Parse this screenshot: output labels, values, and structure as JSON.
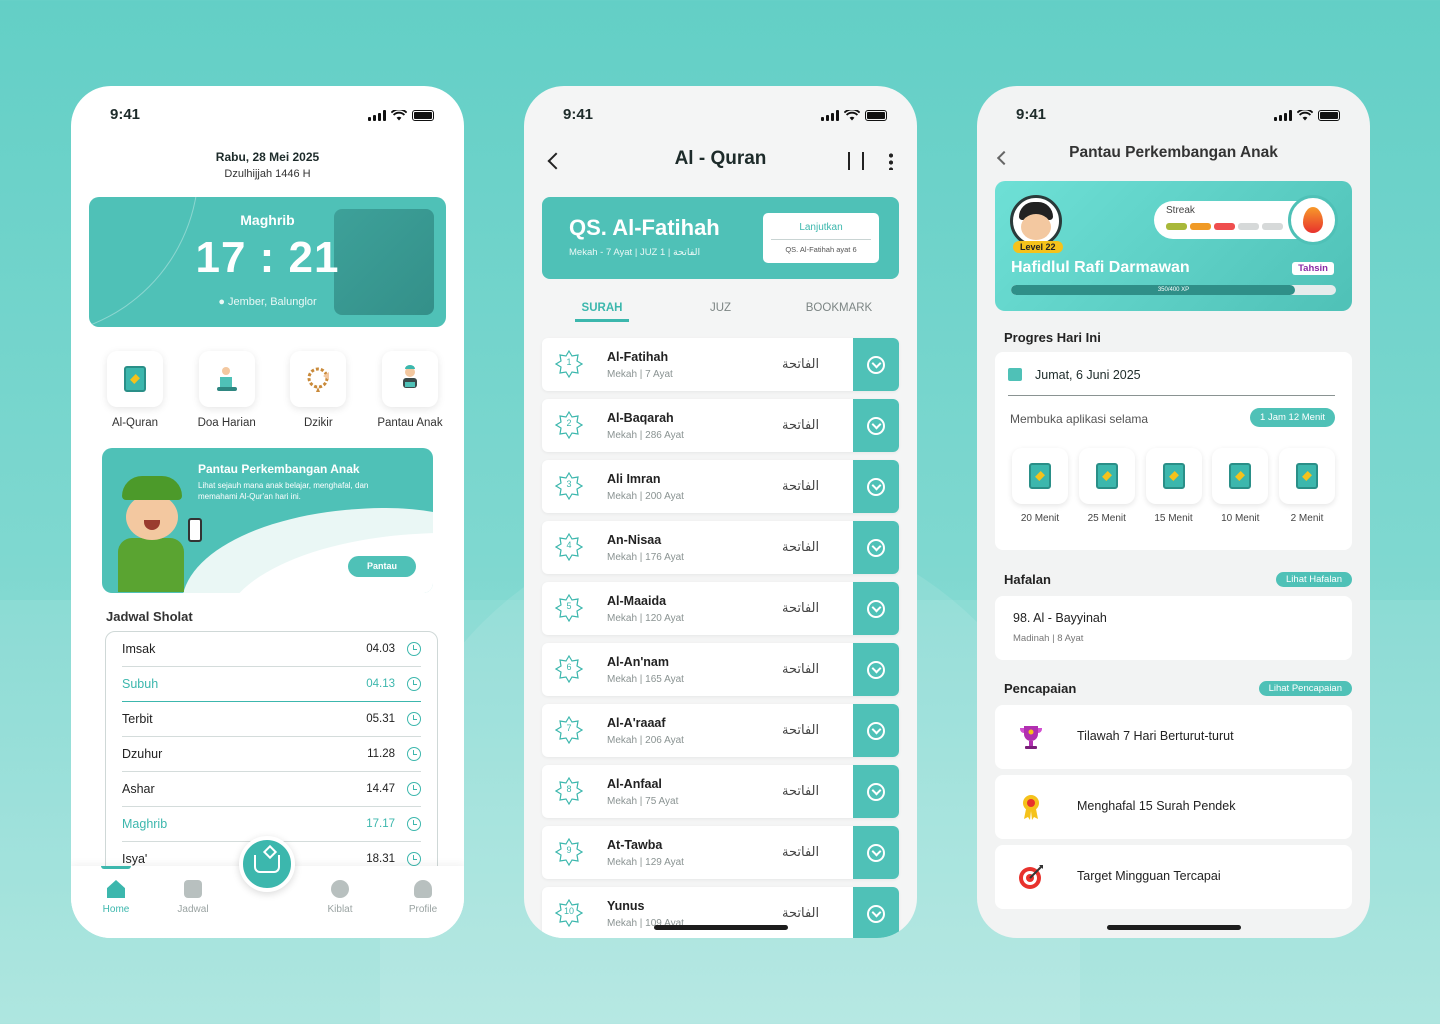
{
  "status": {
    "time": "9:41"
  },
  "phone1": {
    "date": "Rabu, 28 Mei 2025",
    "hijri": "Dzulhijjah 1446 H",
    "prayer_card": {
      "name": "Maghrib",
      "time": "17 : 21",
      "location": "Jember, Balunglor"
    },
    "menu": [
      {
        "label": "Al-Quran",
        "icon": "quran-icon"
      },
      {
        "label": "Doa Harian",
        "icon": "praying-person-icon"
      },
      {
        "label": "Dzikir",
        "icon": "prayer-beads-icon"
      },
      {
        "label": "Pantau Anak",
        "icon": "child-reading-icon"
      }
    ],
    "monitor": {
      "title": "Pantau Perkembangan Anak",
      "desc": "Lihat sejauh mana anak belajar, menghafal, dan memahami Al-Qur'an hari ini.",
      "button": "Pantau"
    },
    "schedule_title": "Jadwal Sholat",
    "schedule": [
      {
        "name": "Imsak",
        "time": "04.03",
        "active": false
      },
      {
        "name": "Subuh",
        "time": "04.13",
        "active": true
      },
      {
        "name": "Terbit",
        "time": "05.31",
        "active": false
      },
      {
        "name": "Dzuhur",
        "time": "11.28",
        "active": false
      },
      {
        "name": "Ashar",
        "time": "14.47",
        "active": false
      },
      {
        "name": "Maghrib",
        "time": "17.17",
        "active": true
      },
      {
        "name": "Isya'",
        "time": "18.31",
        "active": false
      }
    ],
    "nav": {
      "home": "Home",
      "jadwal": "Jadwal",
      "kiblat": "Kiblat",
      "profile": "Profile"
    }
  },
  "phone2": {
    "title": "Al - Quran",
    "last_read": {
      "name": "QS. Al-Fatihah",
      "meta": "Mekah - 7 Ayat   |   JUZ 1   |   الفاتحة",
      "button": "Lanjutkan",
      "sub": "QS. Al-Fatihah ayat 6"
    },
    "tabs": [
      "SURAH",
      "JUZ",
      "BOOKMARK"
    ],
    "surahs": [
      {
        "num": "1",
        "name": "Al-Fatihah",
        "meta": "Mekah | 7 Ayat",
        "arabic": "الفاتحة"
      },
      {
        "num": "2",
        "name": "Al-Baqarah",
        "meta": "Mekah | 286 Ayat",
        "arabic": "الفاتحة"
      },
      {
        "num": "3",
        "name": "Ali Imran",
        "meta": "Mekah | 200 Ayat",
        "arabic": "الفاتحة"
      },
      {
        "num": "4",
        "name": "An-Nisaa",
        "meta": "Mekah | 176 Ayat",
        "arabic": "الفاتحة"
      },
      {
        "num": "5",
        "name": "Al-Maaida",
        "meta": "Mekah | 120 Ayat",
        "arabic": "الفاتحة"
      },
      {
        "num": "6",
        "name": "Al-An'nam",
        "meta": "Mekah | 165 Ayat",
        "arabic": "الفاتحة"
      },
      {
        "num": "7",
        "name": "Al-A'raaaf",
        "meta": "Mekah | 206 Ayat",
        "arabic": "الفاتحة"
      },
      {
        "num": "8",
        "name": "Al-Anfaal",
        "meta": "Mekah | 75 Ayat",
        "arabic": "الفاتحة"
      },
      {
        "num": "9",
        "name": "At-Tawba",
        "meta": "Mekah | 129 Ayat",
        "arabic": "الفاتحة"
      },
      {
        "num": "10",
        "name": "Yunus",
        "meta": "Mekah | 109 Ayat",
        "arabic": "الفاتحة"
      }
    ]
  },
  "phone3": {
    "title": "Pantau Perkembangan Anak",
    "profile": {
      "level": "Level 22",
      "streak_label": "Streak",
      "streak_colors": [
        "#a8b83a",
        "#f09a26",
        "#ef4e4e",
        "#d6d9d9",
        "#d6d9d9"
      ],
      "name": "Hafidlul Rafi Darmawan",
      "badge": "Tahsin",
      "xp_text": "350/400 XP",
      "xp_fraction": 0.875
    },
    "today_title": "Progres Hari Ini",
    "today_date": "Jumat, 6 Juni 2025",
    "open_label": "Membuka aplikasi selama",
    "open_duration": "1 Jam 12 Menit",
    "minutes": [
      "20 Menit",
      "25 Menit",
      "15 Menit",
      "10 Menit",
      "2 Menit"
    ],
    "hafalan_title": "Hafalan",
    "hafalan_button": "Lihat Hafalan",
    "hafalan_item": {
      "title": "98. Al - Bayyinah",
      "meta": "Madinah  |  8 Ayat"
    },
    "ach_title": "Pencapaian",
    "ach_button": "Lihat Pencapaian",
    "achievements": [
      {
        "label": "Tilawah 7 Hari Berturut-turut",
        "icon": "trophy-icon"
      },
      {
        "label": "Menghafal 15 Surah Pendek",
        "icon": "medal-icon"
      },
      {
        "label": "Target Mingguan Tercapai",
        "icon": "target-icon"
      }
    ]
  }
}
